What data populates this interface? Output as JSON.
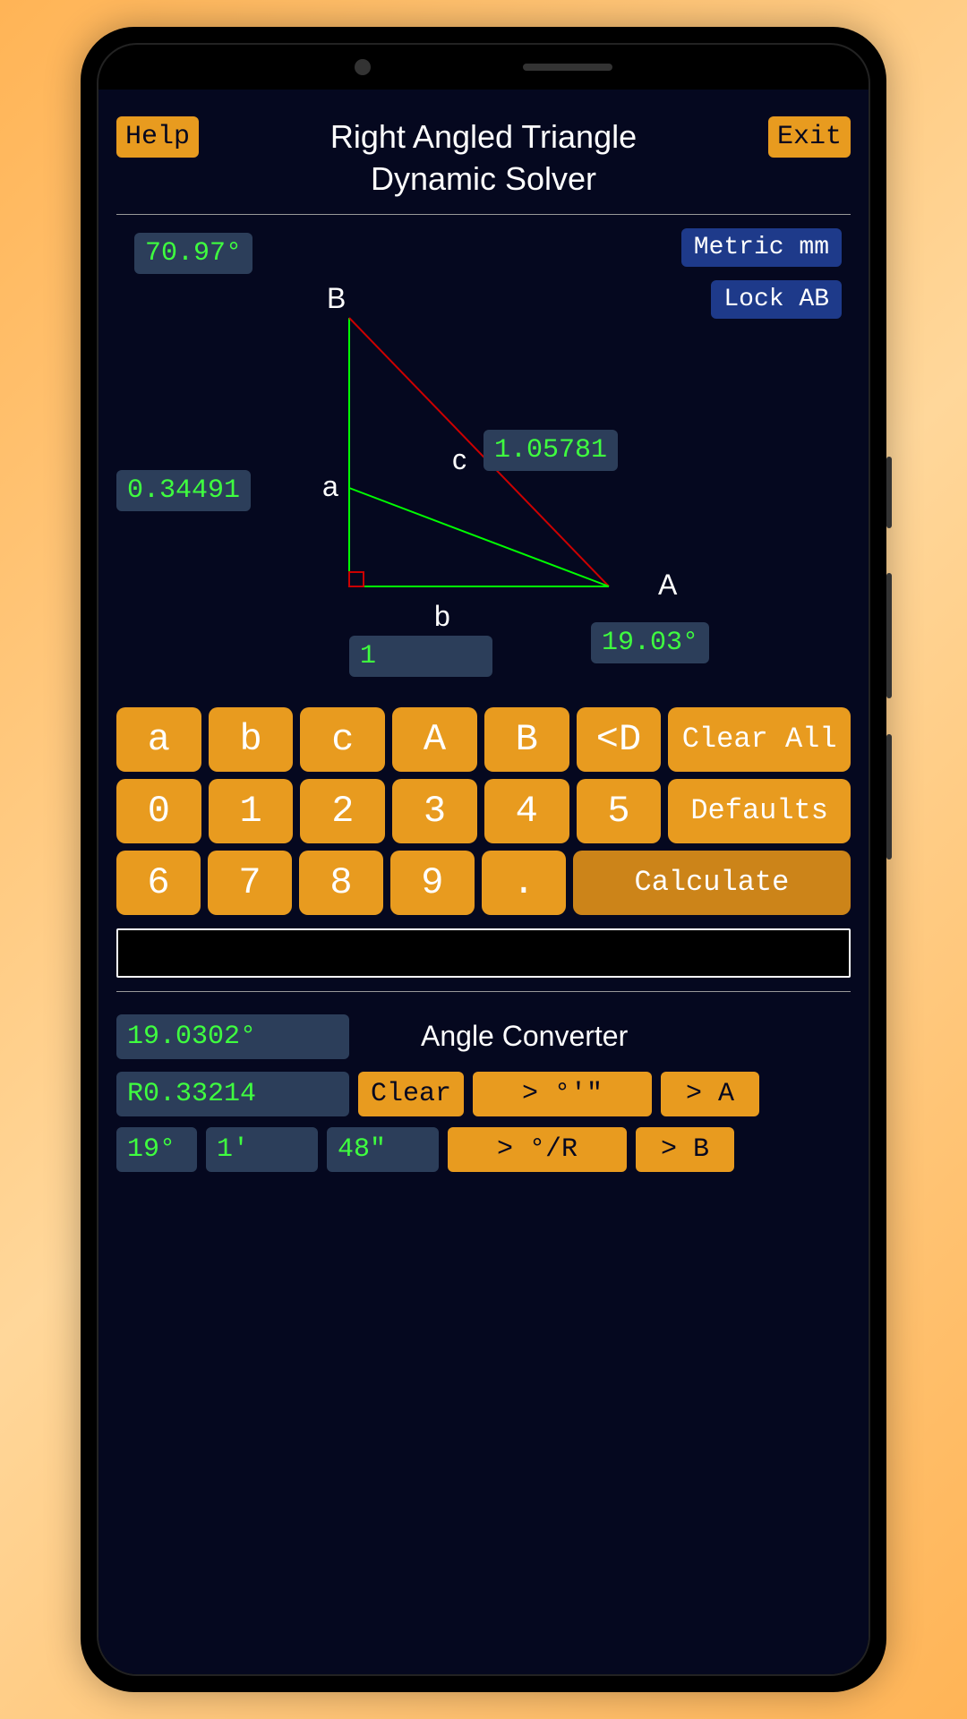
{
  "header": {
    "help": "Help",
    "exit": "Exit",
    "title_line1": "Right Angled Triangle",
    "title_line2": "Dynamic  Solver"
  },
  "controls": {
    "metric": "Metric mm",
    "lock": "Lock AB"
  },
  "triangle": {
    "angle_B": "70.97°",
    "side_a": "0.34491",
    "side_c": "1.05781",
    "side_b": "1",
    "angle_A": "19.03°",
    "vertex_A": "A",
    "vertex_B": "B",
    "label_a": "a",
    "label_b": "b",
    "label_c": "c"
  },
  "keypad": {
    "r1": [
      "a",
      "b",
      "c",
      "A",
      "B",
      "<D"
    ],
    "r1_wide": "Clear All",
    "r2": [
      "0",
      "1",
      "2",
      "3",
      "4",
      "5"
    ],
    "r2_wide": "Defaults",
    "r3": [
      "6",
      "7",
      "8",
      "9",
      "."
    ],
    "r3_wide": "Calculate"
  },
  "converter": {
    "title": "Angle Converter",
    "degrees": "19.0302°",
    "radians": "R0.33214",
    "clear": "Clear",
    "to_dms": "> °'\"",
    "to_A": "> A",
    "deg": "19°",
    "min": "1'",
    "sec": "48\"",
    "to_dr": "> °/R",
    "to_B": "> B"
  }
}
